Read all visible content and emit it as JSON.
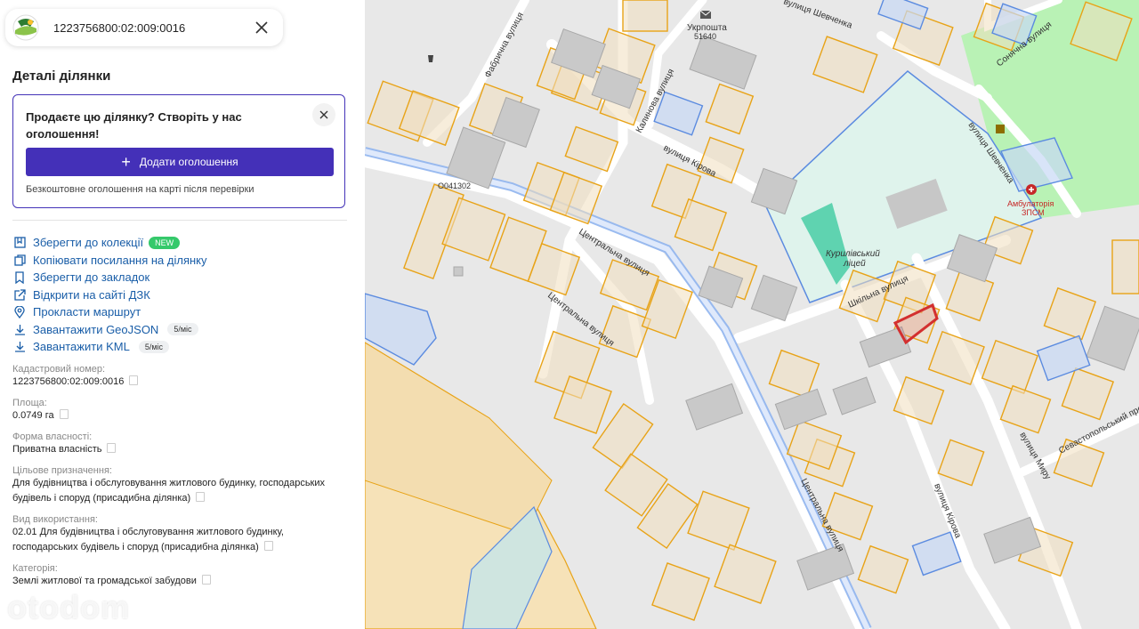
{
  "header": {
    "cadastral_number": "1223756800:02:009:0016"
  },
  "section_title": "Деталі ділянки",
  "promo": {
    "title": "Продаєте цю ділянку? Створіть у нас оголошення!",
    "button_label": "Додати оголошення",
    "note": "Безкоштовне оголошення на карті після перевірки"
  },
  "actions": [
    {
      "label": "Зберегти до колекції",
      "badge": "NEW",
      "icon": "collection-icon"
    },
    {
      "label": "Копіювати посилання на ділянку",
      "icon": "copy-link-icon"
    },
    {
      "label": "Зберегти до закладок",
      "icon": "bookmark-icon"
    },
    {
      "label": "Відкрити на сайті ДЗК",
      "icon": "external-link-icon"
    },
    {
      "label": "Прокласти маршрут",
      "icon": "location-pin-icon"
    },
    {
      "label": "Завантажити GeoJSON",
      "badge": "5/міс",
      "icon": "download-icon"
    },
    {
      "label": "Завантажити KML",
      "badge": "5/міс",
      "icon": "download-icon"
    }
  ],
  "fields": [
    {
      "label": "Кадастровий номер:",
      "value": "1223756800:02:009:0016"
    },
    {
      "label": "Площа:",
      "value": "0.0749 га"
    },
    {
      "label": "Форма власності:",
      "value": "Приватна власність"
    },
    {
      "label": "Цільове призначення:",
      "value": "Для будівництва і обслуговування житлового будинку, господарських будівель і споруд (присадибна ділянка)"
    },
    {
      "label": "Вид використання:",
      "value": "02.01 Для будівництва і обслуговування житлового будинку, господарських будівель і споруд (присадибна ділянка)"
    },
    {
      "label": "Категорія:",
      "value": "Землі житлової та громадської забудови"
    }
  ],
  "watermark": "otodom",
  "map": {
    "labels": {
      "shevchenka_top": "вулиця Шевченка",
      "post_office": "Укрпошта",
      "post_index": "51640",
      "fabrychna": "Фабрична вулиця",
      "kalynova": "Калинова вулиця",
      "kirova_top": "вулиця Кірова",
      "road_code": "O041302",
      "tsentralna_1": "Центральна вулиця",
      "tsentralna_2": "Центральна вулиця",
      "tsentralna_3": "Центральна вулиця",
      "sonyachna": "Сонячна вулиця",
      "shevchenka_right": "вулиця Шевченка",
      "ambulatory": "Амбулаторія",
      "ambulatory_sub": "ЗПСМ",
      "lyceum": "Курилівський",
      "lyceum_sub": "ліцей",
      "shkilna": "Шкільна вулиця",
      "myru": "вулиця Миру",
      "sevastopolskyi": "Севастопольський провулок",
      "kirova_bottom": "вулиця Кірова"
    },
    "colors": {
      "parcel_orange": "#e8a317",
      "parcel_blue": "#5b8be0",
      "highlight": "#d32f2f",
      "park_green": "#b9f2b5",
      "school_fill": "#dff3ec",
      "teal": "#5fd3b0",
      "road_blue": "#8fb4ee"
    }
  }
}
